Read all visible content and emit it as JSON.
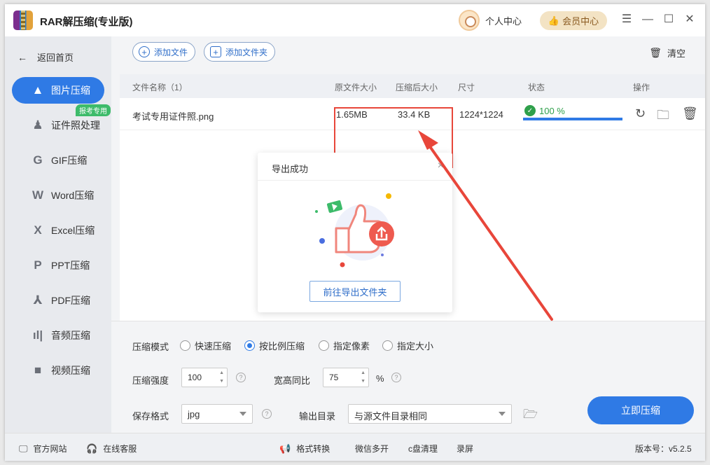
{
  "app": {
    "title": "RAR解压缩(专业版)",
    "user_center": "个人中心",
    "vip_center": "会员中心"
  },
  "sidebar": {
    "back_home": "返回首页",
    "items": [
      {
        "label": "图片压缩",
        "icon": "image-icon"
      },
      {
        "label": "证件照处理",
        "icon": "id-photo-icon",
        "badge": "报考专用"
      },
      {
        "label": "GIF压缩",
        "icon": "gif-icon"
      },
      {
        "label": "Word压缩",
        "icon": "word-icon"
      },
      {
        "label": "Excel压缩",
        "icon": "excel-icon"
      },
      {
        "label": "PPT压缩",
        "icon": "ppt-icon"
      },
      {
        "label": "PDF压缩",
        "icon": "pdf-icon"
      },
      {
        "label": "音频压缩",
        "icon": "audio-icon"
      },
      {
        "label": "视频压缩",
        "icon": "video-icon"
      }
    ],
    "active_index": 0
  },
  "toolbar": {
    "add_file": "添加文件",
    "add_folder": "添加文件夹",
    "clear": "清空"
  },
  "table": {
    "headers": {
      "name": "文件名称（1）",
      "original_size": "原文件大小",
      "compressed_size": "压缩后大小",
      "dimensions": "尺寸",
      "status": "状态",
      "actions": "操作"
    },
    "rows": [
      {
        "name": "考试专用证件照.png",
        "original_size": "1.65MB",
        "compressed_size": "33.4 KB",
        "dimensions": "1224*1224",
        "status": "100 %",
        "progress": 1.0
      }
    ]
  },
  "settings": {
    "mode_label": "压缩模式",
    "modes": [
      "快速压缩",
      "按比例压缩",
      "指定像素",
      "指定大小"
    ],
    "selected_mode": 1,
    "strength_label": "压缩强度",
    "strength_value": "100",
    "ratio_label": "宽高同比",
    "ratio_value": "75",
    "ratio_unit": "%",
    "format_label": "保存格式",
    "format_value": "jpg",
    "output_label": "输出目录",
    "output_value": "与源文件目录相同",
    "compress_button": "立即压缩"
  },
  "footer": {
    "website": "官方网站",
    "support": "在线客服",
    "format_convert": "格式转换",
    "wechat": "微信多开",
    "disk_clean": "c盘清理",
    "record": "录屏",
    "version": "版本号：v5.2.5"
  },
  "modal": {
    "title": "导出成功",
    "button": "前往导出文件夹"
  },
  "colors": {
    "accent": "#2f7ae5",
    "success": "#2fa04b",
    "highlight": "#e8463a",
    "vip": "#f3e3c4"
  }
}
